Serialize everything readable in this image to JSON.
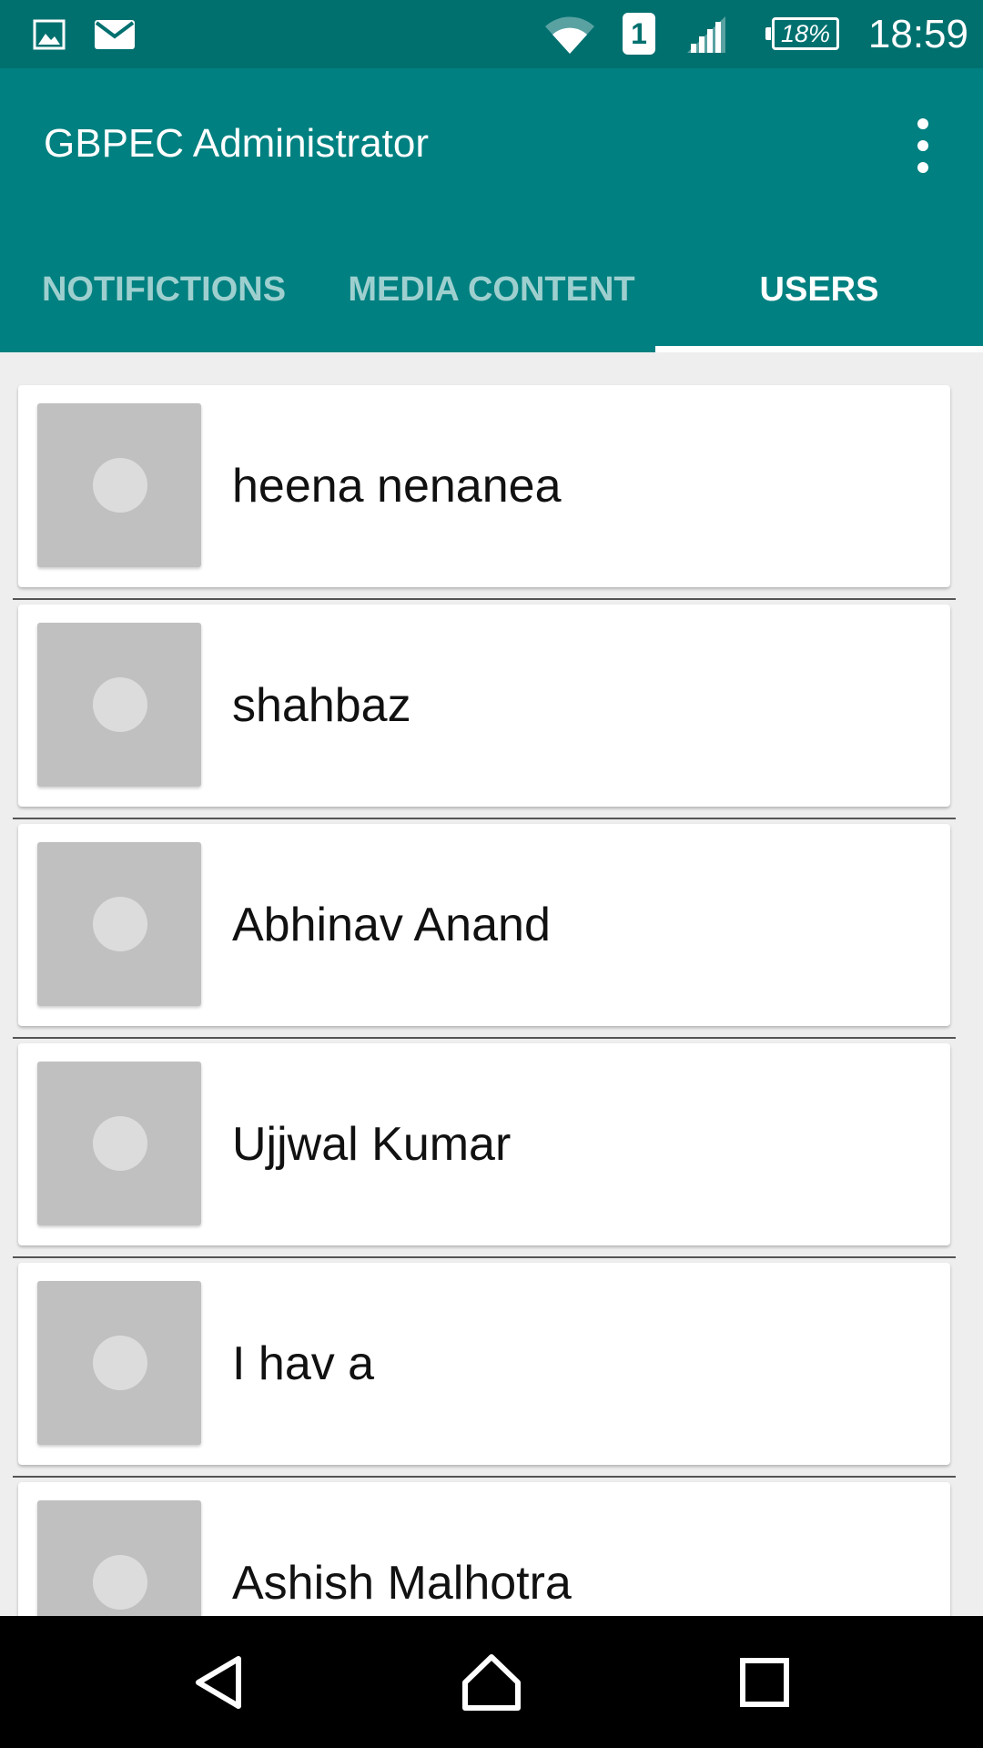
{
  "status_bar": {
    "time": "18:59",
    "battery": "18%",
    "sim_slot": "1",
    "icons": [
      "image-icon",
      "mail-icon",
      "wifi-icon",
      "sim-icon",
      "signal-icon",
      "battery-icon"
    ]
  },
  "app_bar": {
    "title": "GBPEC Administrator",
    "overflow_icon": "more-vert-icon",
    "tabs": [
      {
        "label": "NOTIFICTIONS",
        "active": false
      },
      {
        "label": "MEDIA CONTENT",
        "active": false
      },
      {
        "label": "USERS",
        "active": true
      }
    ]
  },
  "users": [
    {
      "name": "heena nenanea"
    },
    {
      "name": "shahbaz"
    },
    {
      "name": "Abhinav Anand"
    },
    {
      "name": "Ujjwal Kumar"
    },
    {
      "name": "I hav a"
    },
    {
      "name": "Ashish Malhotra"
    }
  ],
  "nav_bar": {
    "icons": [
      "back-icon",
      "home-icon",
      "recents-icon"
    ]
  },
  "colors": {
    "primary": "#008080",
    "primary_dark": "#00706f",
    "background": "#eeeeee",
    "avatar_placeholder": "#c0c0c0"
  }
}
